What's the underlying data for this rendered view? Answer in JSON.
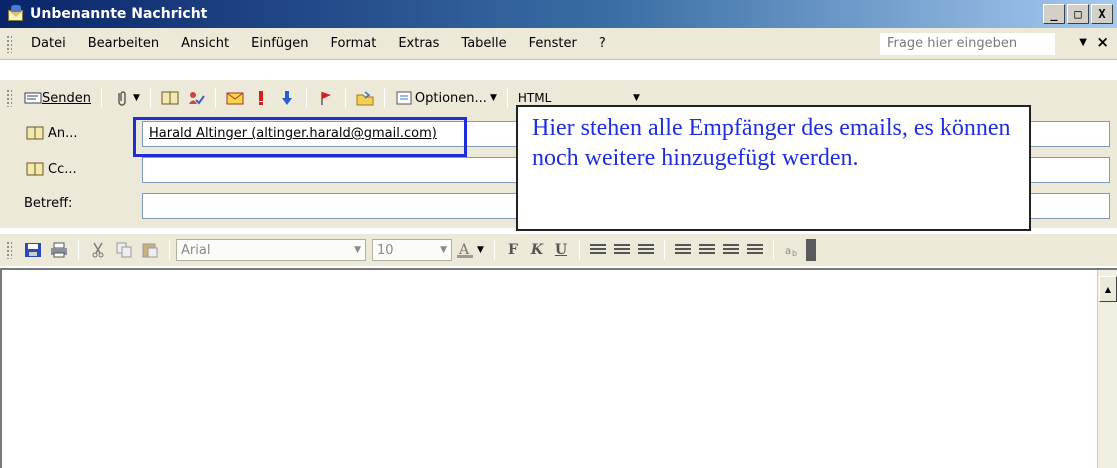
{
  "window": {
    "title": "Unbenannte Nachricht",
    "controls": [
      "_",
      "□",
      "X"
    ]
  },
  "menu": {
    "items": [
      {
        "label": "Datei"
      },
      {
        "label": "Bearbeiten"
      },
      {
        "label": "Ansicht"
      },
      {
        "label": "Einfügen"
      },
      {
        "label": "Format"
      },
      {
        "label": "Extras"
      },
      {
        "label": "Tabelle"
      },
      {
        "label": "Fenster"
      },
      {
        "label": "?"
      }
    ],
    "help_placeholder": "Frage hier eingeben",
    "close_label": "×"
  },
  "toolbar": {
    "send_label": "Senden",
    "options_label": "Optionen...",
    "format_value": "HTML"
  },
  "fields": {
    "to_label": "An...",
    "cc_label": "Cc...",
    "subject_label": "Betreff:",
    "to_value": "Harald Altinger (altinger.harald@gmail.com)",
    "cc_value": "",
    "subject_value": ""
  },
  "callout": {
    "text": "Hier stehen alle Empfänger des emails, es können noch weitere hinzugefügt werden."
  },
  "formatting": {
    "font_name": "Arial",
    "font_size": "10",
    "bold": "F",
    "italic": "K",
    "underline": "U"
  },
  "colors": {
    "titlebar_start": "#0a246a",
    "highlight": "#1f2fd6",
    "callout_text": "#1e2ee0",
    "chrome": "#ece9d8"
  }
}
